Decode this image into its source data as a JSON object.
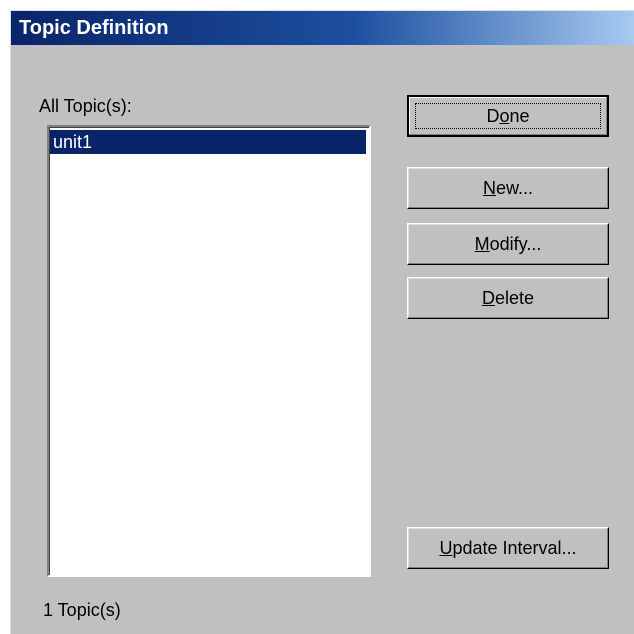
{
  "window": {
    "title": "Topic Definition"
  },
  "topics_label": "All Topic(s):",
  "topics": {
    "items": [
      "unit1"
    ],
    "selected_index": 0
  },
  "topic_count": "1 Topic(s)",
  "buttons": {
    "done": {
      "pre": "D",
      "mnemonic": "o",
      "post": "ne"
    },
    "new": {
      "pre": "",
      "mnemonic": "N",
      "post": "ew..."
    },
    "modify": {
      "pre": "",
      "mnemonic": "M",
      "post": "odify..."
    },
    "delete": {
      "pre": "",
      "mnemonic": "D",
      "post": "elete"
    },
    "update_interval": {
      "pre": "",
      "mnemonic": "U",
      "post": "pdate Interval..."
    }
  },
  "colors": {
    "face": "#c0c0c0",
    "title_start": "#0a246a",
    "title_end": "#a6caf0",
    "selection": "#0a246a"
  }
}
